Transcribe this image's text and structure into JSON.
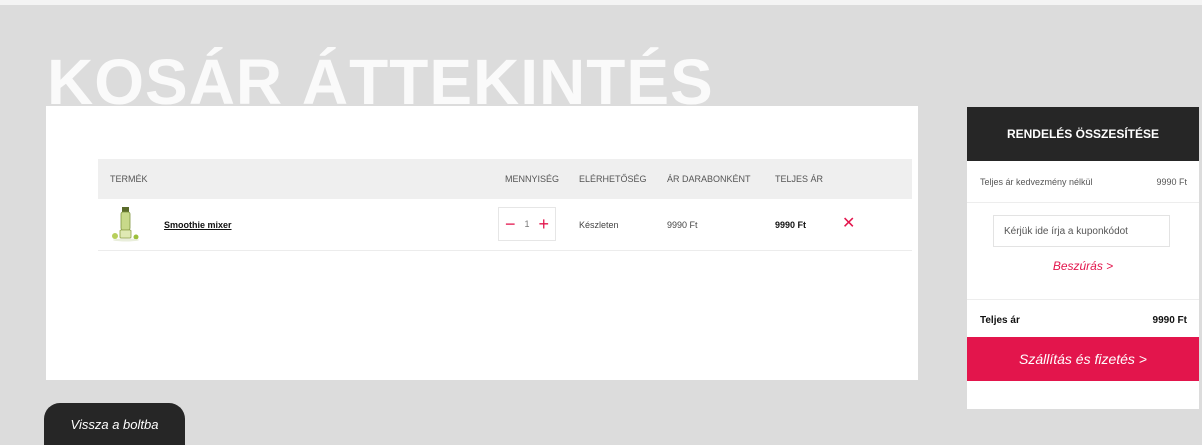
{
  "page": {
    "title": "KOSÁR ÁTTEKINTÉS"
  },
  "cart": {
    "headers": {
      "product": "TERMÉK",
      "quantity": "MENNYISÉG",
      "availability": "ELÉRHETŐSÉG",
      "unit_price": "ÁR DARABONKÉNT",
      "total_price": "TELJES ÁR"
    },
    "items": [
      {
        "name": "Smoothie mixer",
        "quantity": "1",
        "availability": "Készleten",
        "unit_price": "9990 Ft",
        "total_price": "9990 Ft"
      }
    ],
    "icons": {
      "minus": "−",
      "plus": "+",
      "remove": "✕"
    }
  },
  "summary": {
    "title": "RENDELÉS ÖSSZESÍTÉSE",
    "subtotal_label": "Teljes ár kedvezmény nélkül",
    "subtotal_value": "9990 Ft",
    "coupon_placeholder": "Kérjük ide írja a kuponkódot",
    "insert_label": "Beszúrás >",
    "total_label": "Teljes ár",
    "total_value": "9990 Ft",
    "checkout_label": "Szállítás és fizetés >"
  },
  "back_button": "Vissza a boltba",
  "colors": {
    "accent": "#e3154c",
    "dark": "#262626",
    "background": "#dcdcdc"
  }
}
